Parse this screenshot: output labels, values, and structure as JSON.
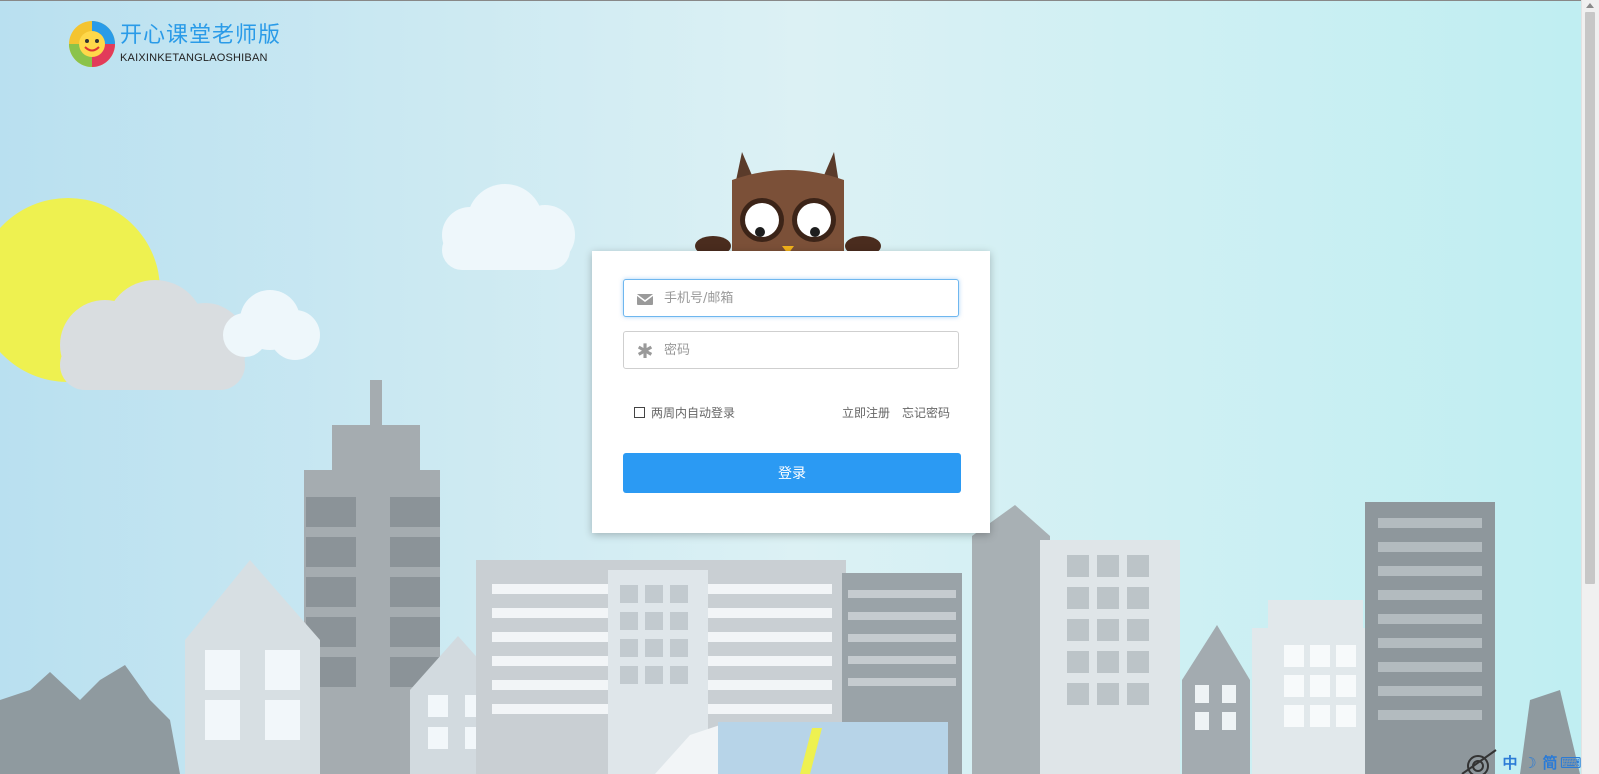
{
  "logo": {
    "title_cn": "开心课堂老师版",
    "title_en": "KAIXINKETANGLAOSHIBAN"
  },
  "login": {
    "account_placeholder": "手机号/邮箱",
    "password_placeholder": "密码",
    "remember_label": "两周内自动登录",
    "register_label": "立即注册",
    "forgot_label": "忘记密码",
    "submit_label": "登录"
  },
  "ime": {
    "lang": "中",
    "mode": "☽",
    "charset": "简",
    "keyboard": "⌨"
  },
  "icons": {
    "account": "envelope-icon",
    "password": "asterisk-icon"
  },
  "colors": {
    "accent": "#2b9af3",
    "logo_text": "#2a9be8",
    "sky": "#c8e9f2"
  }
}
